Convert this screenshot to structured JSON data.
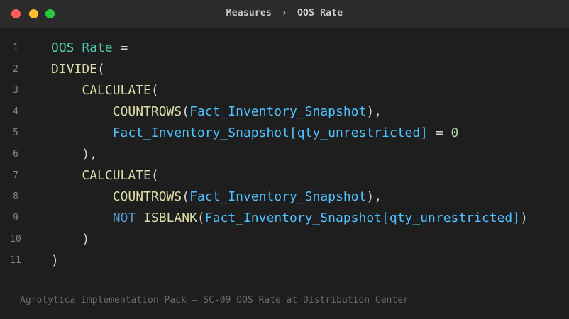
{
  "window": {
    "breadcrumb": [
      "Measures",
      "OOS Rate"
    ],
    "breadcrumb_separator": "›"
  },
  "code_lines": [
    {
      "n": "1",
      "indent": "",
      "tokens": [
        {
          "t": "OOS Rate",
          "c": "measure"
        },
        {
          "t": " =",
          "c": "op"
        }
      ]
    },
    {
      "n": "2",
      "indent": "",
      "tokens": [
        {
          "t": "DIVIDE",
          "c": "fn"
        },
        {
          "t": "(",
          "c": "op"
        }
      ]
    },
    {
      "n": "3",
      "indent": "    ",
      "tokens": [
        {
          "t": "CALCULATE",
          "c": "fn"
        },
        {
          "t": "(",
          "c": "op"
        }
      ]
    },
    {
      "n": "4",
      "indent": "        ",
      "tokens": [
        {
          "t": "COUNTROWS",
          "c": "fn"
        },
        {
          "t": "(",
          "c": "op"
        },
        {
          "t": "Fact_Inventory_Snapshot",
          "c": "tbl"
        },
        {
          "t": "),",
          "c": "op"
        }
      ]
    },
    {
      "n": "5",
      "indent": "        ",
      "tokens": [
        {
          "t": "Fact_Inventory_Snapshot[qty_unrestricted]",
          "c": "tbl"
        },
        {
          "t": " = ",
          "c": "op"
        },
        {
          "t": "0",
          "c": "num"
        }
      ]
    },
    {
      "n": "6",
      "indent": "    ",
      "tokens": [
        {
          "t": "),",
          "c": "op"
        }
      ]
    },
    {
      "n": "7",
      "indent": "    ",
      "tokens": [
        {
          "t": "CALCULATE",
          "c": "fn"
        },
        {
          "t": "(",
          "c": "op"
        }
      ]
    },
    {
      "n": "8",
      "indent": "        ",
      "tokens": [
        {
          "t": "COUNTROWS",
          "c": "fn"
        },
        {
          "t": "(",
          "c": "op"
        },
        {
          "t": "Fact_Inventory_Snapshot",
          "c": "tbl"
        },
        {
          "t": "),",
          "c": "op"
        }
      ]
    },
    {
      "n": "9",
      "indent": "        ",
      "tokens": [
        {
          "t": "NOT",
          "c": "kw"
        },
        {
          "t": " ",
          "c": "op"
        },
        {
          "t": "ISBLANK",
          "c": "fn"
        },
        {
          "t": "(",
          "c": "op"
        },
        {
          "t": "Fact_Inventory_Snapshot[qty_unrestricted]",
          "c": "tbl"
        },
        {
          "t": ")",
          "c": "op"
        }
      ]
    },
    {
      "n": "10",
      "indent": "    ",
      "tokens": [
        {
          "t": ")",
          "c": "op"
        }
      ]
    },
    {
      "n": "11",
      "indent": "",
      "tokens": [
        {
          "t": ")",
          "c": "op"
        }
      ]
    }
  ],
  "footer": {
    "caption": "Agrolytica Implementation Pack — SC-09 OOS Rate at Distribution Center"
  },
  "colors": {
    "background": "#1e1e1e",
    "titlebar": "#2b2b2b",
    "measure": "#4ec9b0",
    "function": "#dcdcaa",
    "table_ref": "#4fc1ff",
    "keyword": "#569cd6",
    "number": "#b5cea8",
    "operator": "#d4d4d4"
  }
}
